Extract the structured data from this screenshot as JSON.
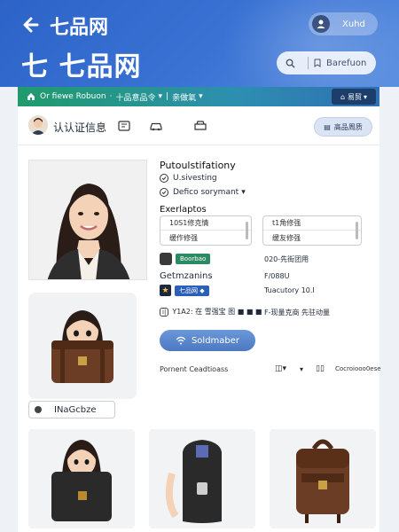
{
  "header": {
    "app_title": "七品网",
    "brand": "七 七品网",
    "profile_text": "Xuhd",
    "search_text": "Barefuon"
  },
  "navbar": {
    "breadcrumb_1": "Or fiewe Robuon",
    "breadcrumb_2": "十品意品令",
    "breadcrumb_3": "亲做氧",
    "right_label": "易贸"
  },
  "toolbar": {
    "title": "认认证信息",
    "button_label": "高品周质"
  },
  "info": {
    "title": "Putoulstifationy",
    "check_1": "U.sivesting",
    "check_2": "Defico sorymant",
    "examples_title": "Exerlaptos",
    "options_left": [
      "10S1修克情",
      "缓作修强"
    ],
    "options_right": [
      "t1角修强",
      "缓友修强"
    ],
    "row1_badge": "Boorbao",
    "row1_right": "020-先街团用",
    "row2_title": "Getmzanins",
    "row2_right": "F/088U",
    "row3_badge": "七品网 ◆",
    "row3_right": "Tuacutory 10.I",
    "row4_left": "Y1A2: 在 雪强宝 图 ■ ■ ■",
    "row4_right": "F-现量克商   先驻动量",
    "primary_button": "Soldmaber",
    "footer_left": "Pornent Ceadtioass",
    "footer_right": "Cocroiooo0ese"
  },
  "thumbnail": {
    "label": "INaGcbze"
  },
  "colors": {
    "header": "#3a73d4",
    "nav_green": "#1f9b6b",
    "primary_button": "#5b88cc",
    "bag_brown": "#6b3d24",
    "bag_black": "#2a2a2a"
  }
}
